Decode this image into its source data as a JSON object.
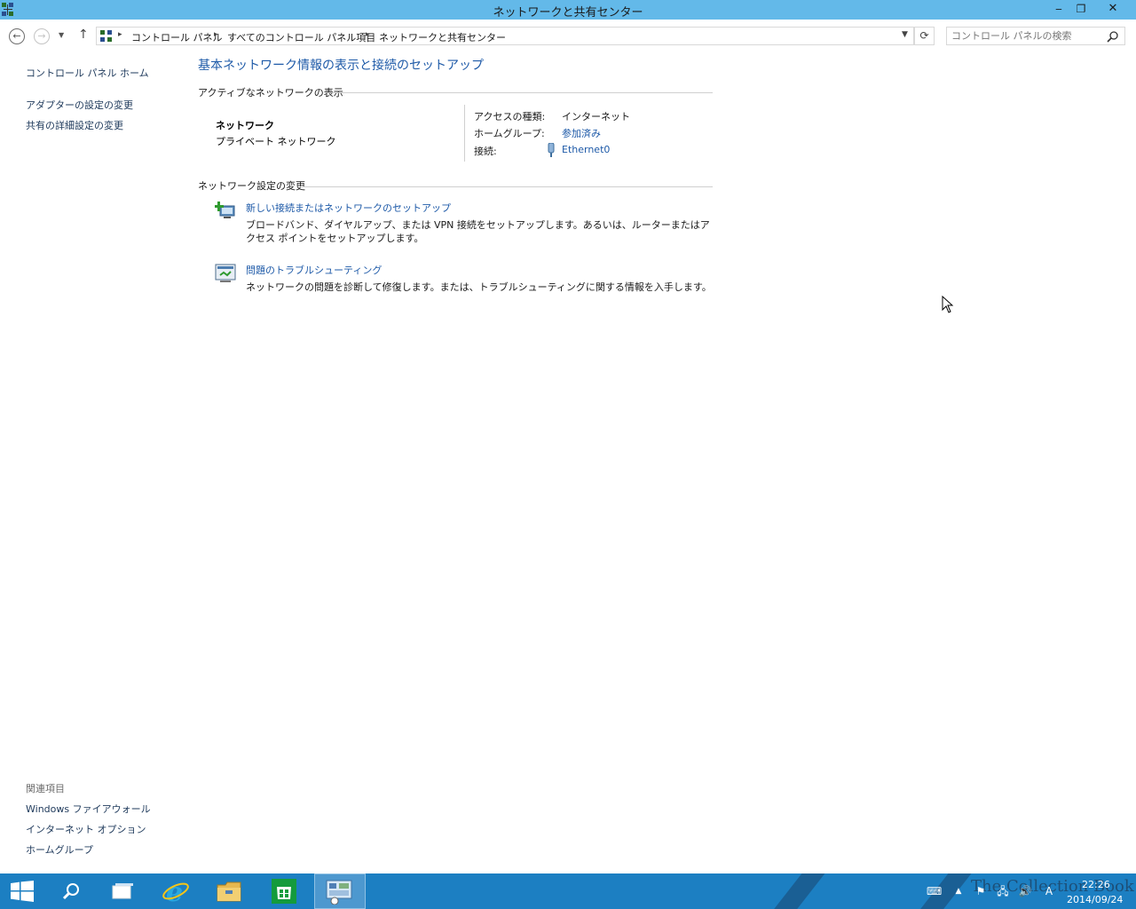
{
  "window": {
    "title": "ネットワークと共有センター",
    "minimize": "‒",
    "restore": "❐",
    "close": "✕"
  },
  "nav": {
    "breadcrumbs": [
      "コントロール パネル",
      "すべてのコントロール パネル項目",
      "ネットワークと共有センター"
    ],
    "search_placeholder": "コントロール パネルの検索"
  },
  "left_pane": {
    "items": [
      "コントロール パネル ホーム",
      "アダプターの設定の変更",
      "共有の詳細設定の変更"
    ]
  },
  "related": {
    "title": "関連項目",
    "items": [
      "Windows ファイアウォール",
      "インターネット オプション",
      "ホームグループ"
    ]
  },
  "main": {
    "title": "基本ネットワーク情報の表示と接続のセットアップ",
    "active_section": "アクティブなネットワークの表示",
    "network": {
      "name": "ネットワーク",
      "type": "プライベート ネットワーク",
      "props": [
        {
          "label": "アクセスの種類:",
          "value": "インターネット"
        },
        {
          "label": "ホームグループ:",
          "value": "参加済み"
        },
        {
          "label": "接続:",
          "value": "Ethernet0"
        }
      ]
    },
    "change_section": "ネットワーク設定の変更",
    "tasks": [
      {
        "link": "新しい接続またはネットワークのセットアップ",
        "desc": "ブロードバンド、ダイヤルアップ、または VPN 接続をセットアップします。あるいは、ルーターまたはアクセス ポイントをセットアップします。"
      },
      {
        "link": "問題のトラブルシューティング",
        "desc": "ネットワークの問題を診断して修復します。または、トラブルシューティングに関する情報を入手します。"
      }
    ]
  },
  "taskbar": {
    "clock_time": "22:26",
    "clock_date": "2014/09/24",
    "ime": "A",
    "watermark": "The Collection Book"
  },
  "colors": {
    "titlebar": "#63b9e9",
    "link": "#1e5aa8",
    "taskbar": "#1c7fc2"
  }
}
